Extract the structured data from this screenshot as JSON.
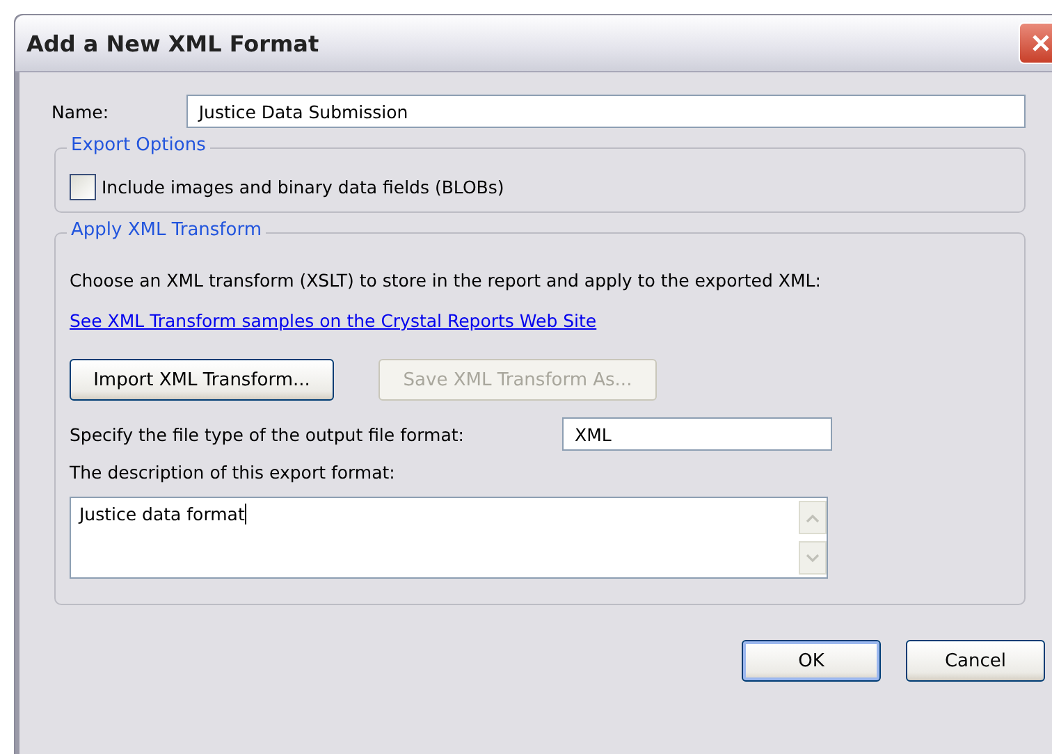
{
  "window": {
    "title": "Add a New XML Format"
  },
  "name_field": {
    "label": "Name:",
    "value": "Justice Data Submission"
  },
  "export_options": {
    "title": "Export Options",
    "checkbox": {
      "label": "Include images and binary data fields (BLOBs)",
      "checked": false
    }
  },
  "apply_xml_transform": {
    "title": "Apply XML Transform",
    "instruction": "Choose an XML transform (XSLT) to store in the report and apply to the exported XML:",
    "link": "See XML Transform samples on the Crystal Reports Web Site",
    "buttons": [
      {
        "label": "Import XML Transform...",
        "disabled": false
      },
      {
        "label": "Save XML Transform As...",
        "disabled": true
      }
    ],
    "file_type": {
      "label": "Specify the file type of the output file format:",
      "value": "XML"
    },
    "description": {
      "label": "The description of this export format:",
      "value": "Justice data format"
    }
  },
  "buttons": [
    {
      "label": "OK",
      "default": true
    },
    {
      "label": "Cancel",
      "default": false
    }
  ]
}
